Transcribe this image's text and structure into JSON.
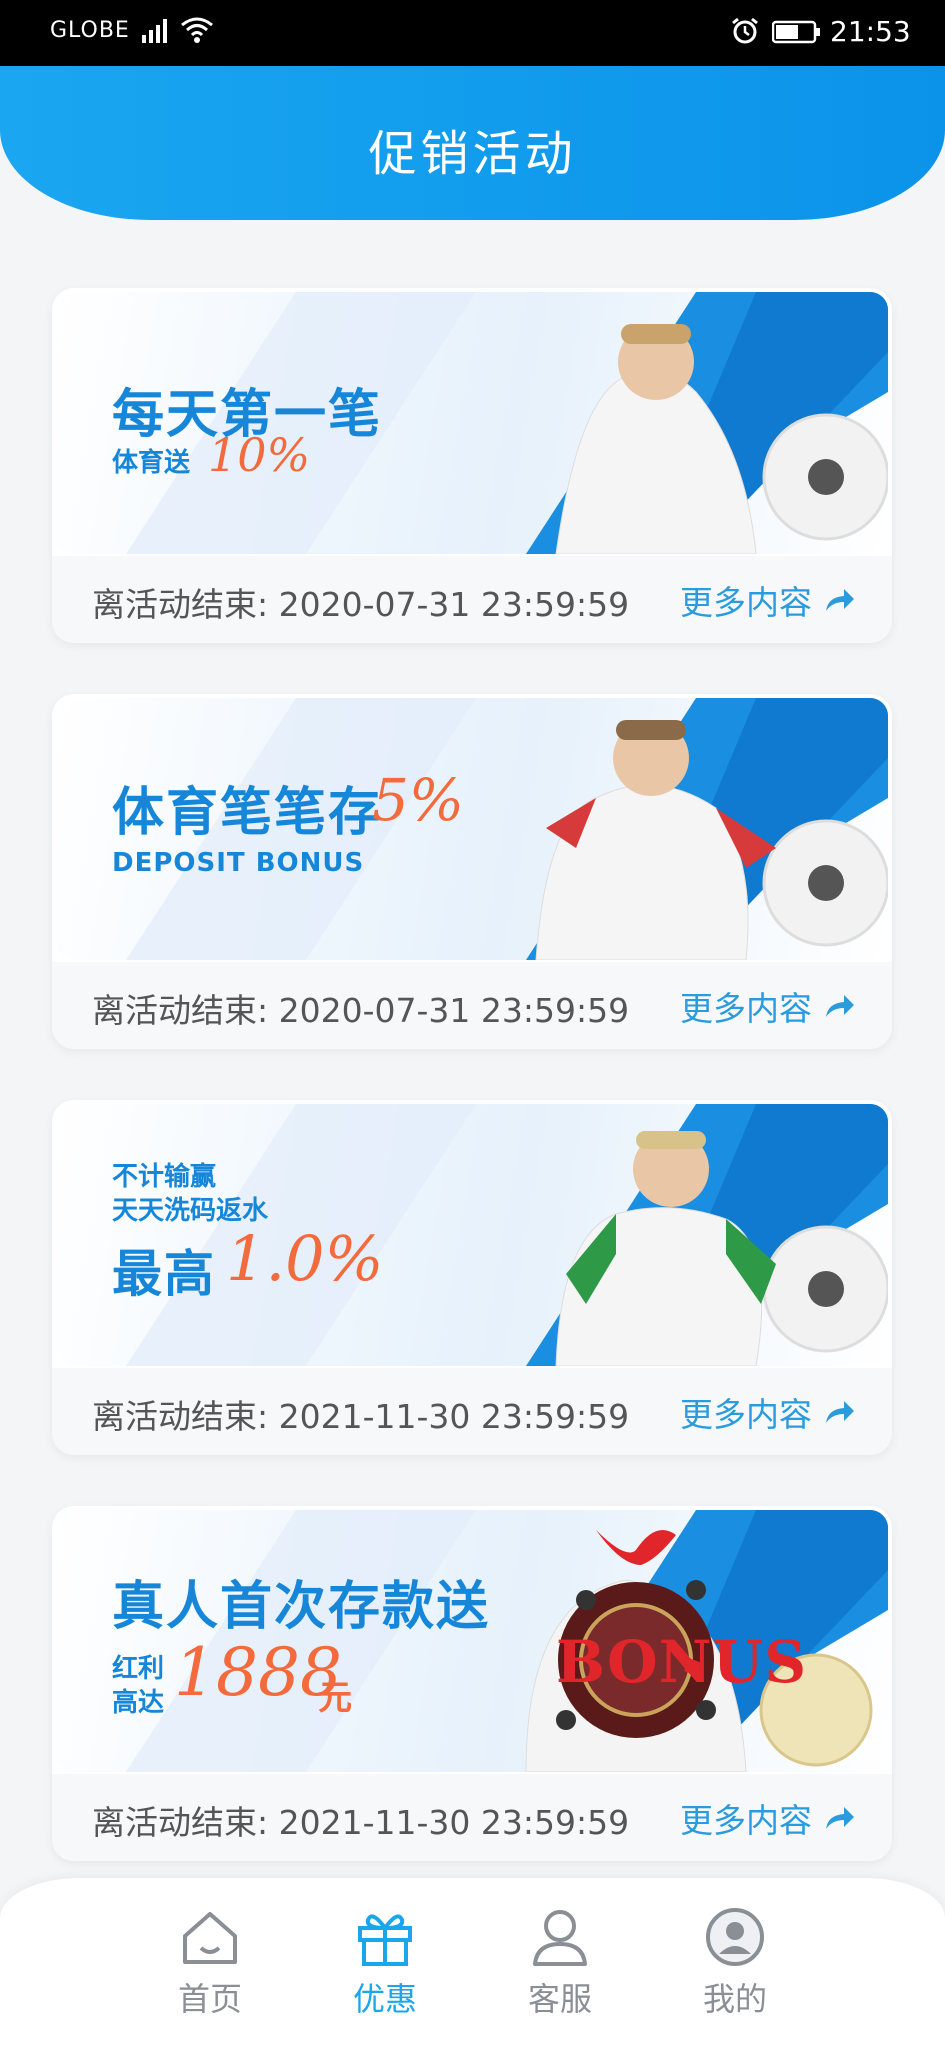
{
  "status_bar": {
    "carrier": "GLOBE",
    "time": "21:53"
  },
  "header": {
    "title": "促销活动"
  },
  "promotions": [
    {
      "title": "每天第一笔",
      "subtitle": "体育送",
      "highlight": "10%",
      "end_label": "离活动结束: 2020-07-31 23:59:59",
      "more_label": "更多内容"
    },
    {
      "title": "体育笔笔存",
      "highlight": "5%",
      "subtitle": "DEPOSIT BONUS",
      "end_label": "离活动结束: 2020-07-31 23:59:59",
      "more_label": "更多内容"
    },
    {
      "line1": "不计输赢",
      "line2": "天天洗码返水",
      "title": "最高",
      "highlight": "1.0%",
      "end_label": "离活动结束: 2021-11-30 23:59:59",
      "more_label": "更多内容"
    },
    {
      "title": "真人首次存款送",
      "line1": "红利",
      "line2": "高达",
      "highlight": "1888",
      "unit": "元",
      "badge": "BONUS",
      "end_label": "离活动结束: 2021-11-30 23:59:59",
      "more_label": "更多内容"
    }
  ],
  "nav": [
    {
      "label": "首页",
      "icon": "home-icon"
    },
    {
      "label": "优惠",
      "icon": "gift-icon",
      "active": true
    },
    {
      "label": "客服",
      "icon": "support-icon"
    },
    {
      "label": "我的",
      "icon": "profile-icon"
    }
  ],
  "colors": {
    "accent": "#1aa6f0",
    "promo_highlight": "#f36a3d",
    "link": "#2a9bdc"
  }
}
